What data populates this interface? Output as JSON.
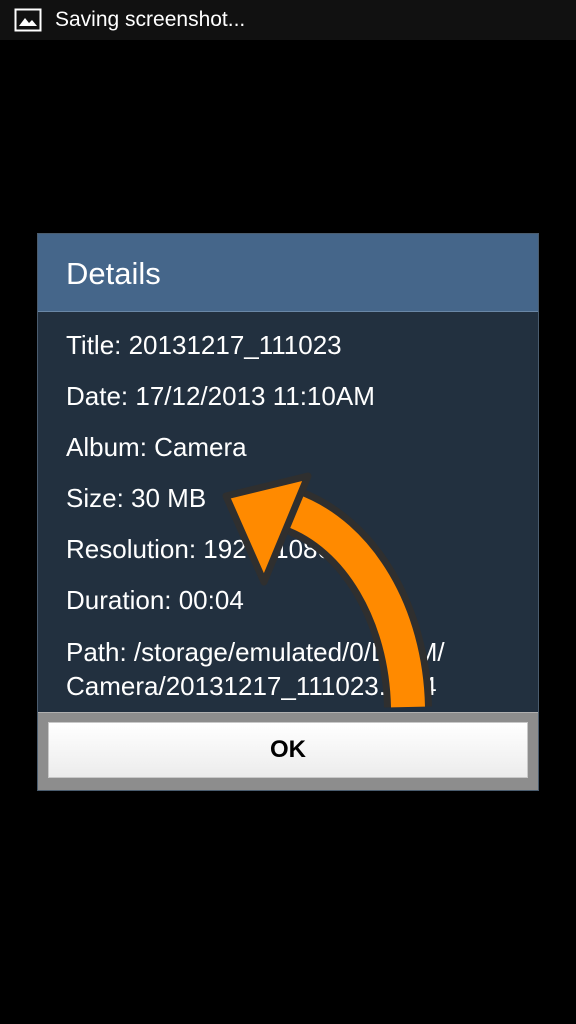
{
  "status_bar": {
    "icon": "image-icon",
    "text": "Saving screenshot..."
  },
  "dialog": {
    "title": "Details",
    "rows": [
      "Title: 20131217_111023",
      "Date: 17/12/2013 11:10AM",
      "Album: Camera",
      "Size: 30 MB",
      "Resolution: 1920x1080",
      "Duration: 00:04",
      "Path: /storage/emulated/0/DCIM/",
      "Camera/20131217_111023.mp4"
    ],
    "ok_label": "OK"
  },
  "colors": {
    "header": "#45668a",
    "body": "#22303f",
    "arrow": "#ff8a00"
  },
  "annotation": {
    "icon": "curved-arrow-icon"
  }
}
